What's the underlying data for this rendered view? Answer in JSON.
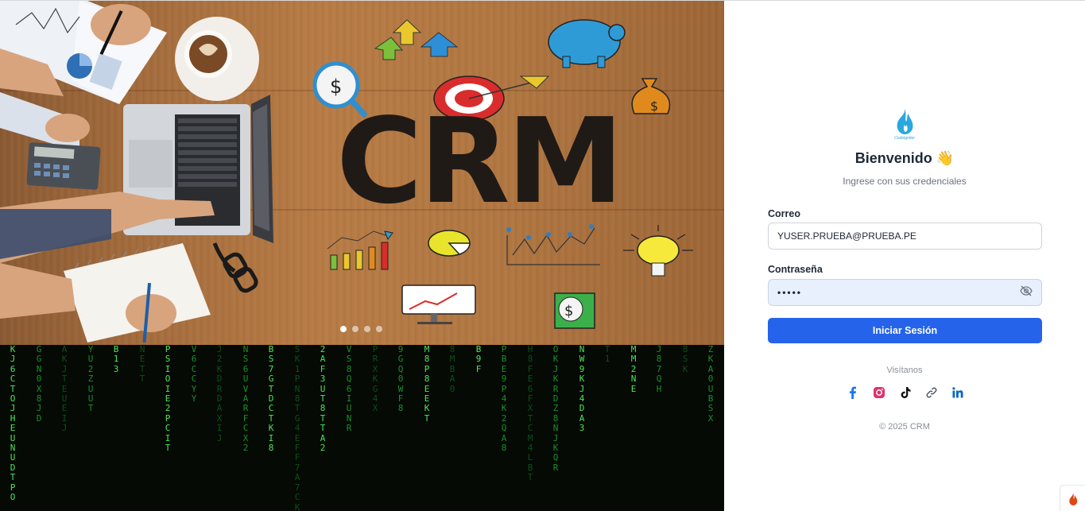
{
  "hero": {
    "headline": "CRM",
    "carousel_slides": 4,
    "active_slide": 1
  },
  "matrix": {
    "columns": [
      "KJ6CTOJHEUNUDTPO",
      "GGN0X8JD",
      "AKJTEUEIJ",
      "YU2ZUUT",
      "B13",
      "NETT",
      "PSIOIE2PCIT",
      "V6CCYY",
      "J2KDRDAXIJ",
      "NS6UVARFCX2",
      "BS7GTDCTKI8",
      "SK1PN8TG4EFF7A7CKL",
      "2AF3UT8TTA2",
      "VS8Q6IUNR",
      "PRXKG4X",
      "9GQ0WF8",
      "M8P8EEKT",
      "8MBA0",
      "B9F",
      "PBE9P4K2QA8",
      "H8FE6FXTCM4LBT",
      "OKJKRDZ8NJKQR",
      "NW9KJ4DA3",
      "T1",
      "MM2NE",
      "J87QH",
      "8SK",
      "ZKA0UBSX"
    ],
    "colors": {
      "bright": "#4ee35a",
      "mid": "#1a8f2a",
      "dim": "#0e4f17"
    }
  },
  "login": {
    "brand_name": "CodeIgniter",
    "title": "Bienvenido 👋",
    "subtitle": "Ingrese con sus credenciales",
    "email_label": "Correo",
    "email_value": "YUSER.PRUEBA@PRUEBA.PE",
    "password_label": "Contraseña",
    "password_value": "•••••",
    "submit_label": "Iniciar Sesión",
    "social_title": "Visítanos",
    "social": [
      {
        "icon": "facebook-icon",
        "color": "#1877f2"
      },
      {
        "icon": "instagram-icon",
        "color": "#e1306c"
      },
      {
        "icon": "tiktok-icon",
        "color": "#111111"
      },
      {
        "icon": "link-icon",
        "color": "#4b5563"
      },
      {
        "icon": "linkedin-icon",
        "color": "#0a66c2"
      }
    ],
    "copyright": "© 2025 CRM"
  },
  "colors": {
    "primary": "#2563eb",
    "wood": "#b07641",
    "matrix_bg": "#050a05"
  }
}
